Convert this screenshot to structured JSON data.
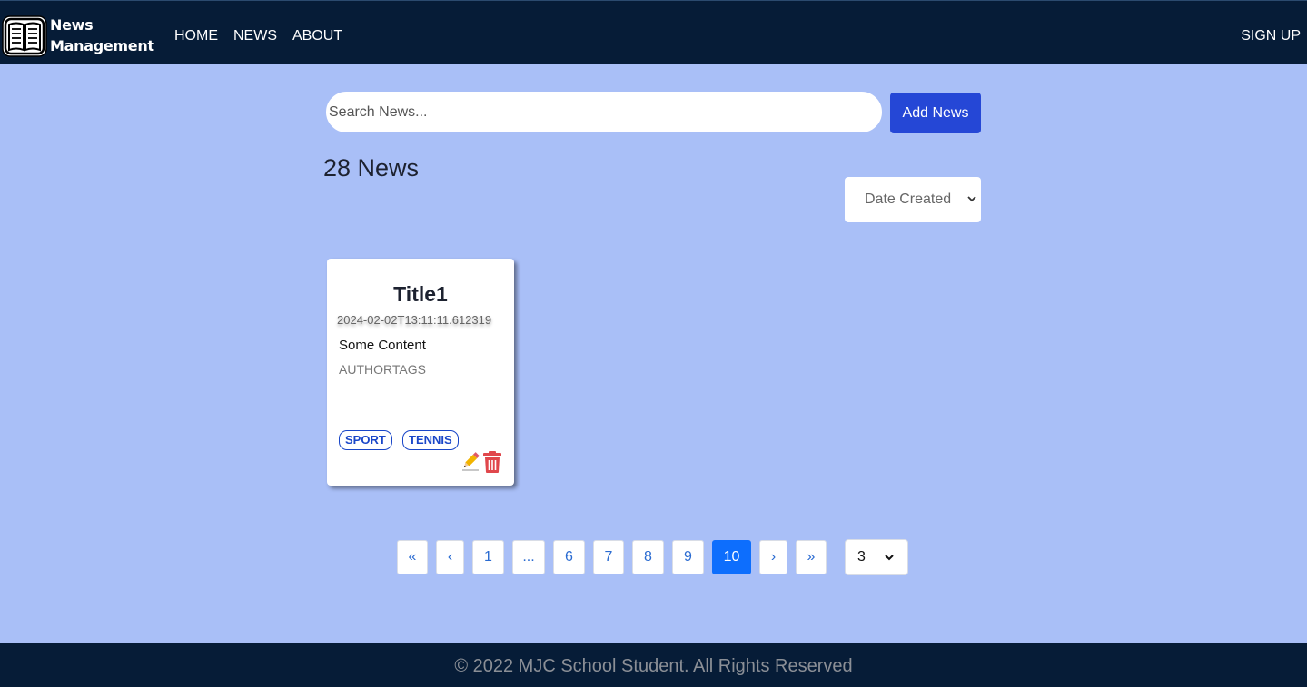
{
  "nav": {
    "brand_line1": "News",
    "brand_line2": "Management",
    "links": [
      "HOME",
      "NEWS",
      "ABOUT"
    ],
    "signup_label": "SIGN UP"
  },
  "search": {
    "placeholder": "Search News...",
    "value": "",
    "add_button_label": "Add News"
  },
  "list": {
    "count_label": "28 News",
    "sort_selected": "Date Created"
  },
  "cards": [
    {
      "title": "Title1",
      "date": "2024-02-02T13:11:11.612319",
      "content": "Some Content",
      "author": "AUTHORTAGS",
      "tags": [
        "SPORT",
        "TENNIS"
      ]
    }
  ],
  "pagination": {
    "first": "«",
    "prev": "‹",
    "pages": [
      "1",
      "...",
      "6",
      "7",
      "8",
      "9",
      "10"
    ],
    "active": "10",
    "next": "›",
    "last": "»",
    "per_page": "3"
  },
  "footer": {
    "text": "© 2022 MJC School Student. All Rights Reserved"
  },
  "colors": {
    "navbar": "#061c37",
    "background": "#a9bff7",
    "primary_button": "#2547d6",
    "active_page": "#0d6efd",
    "tag": "#1946c8",
    "delete": "#e0474c"
  }
}
